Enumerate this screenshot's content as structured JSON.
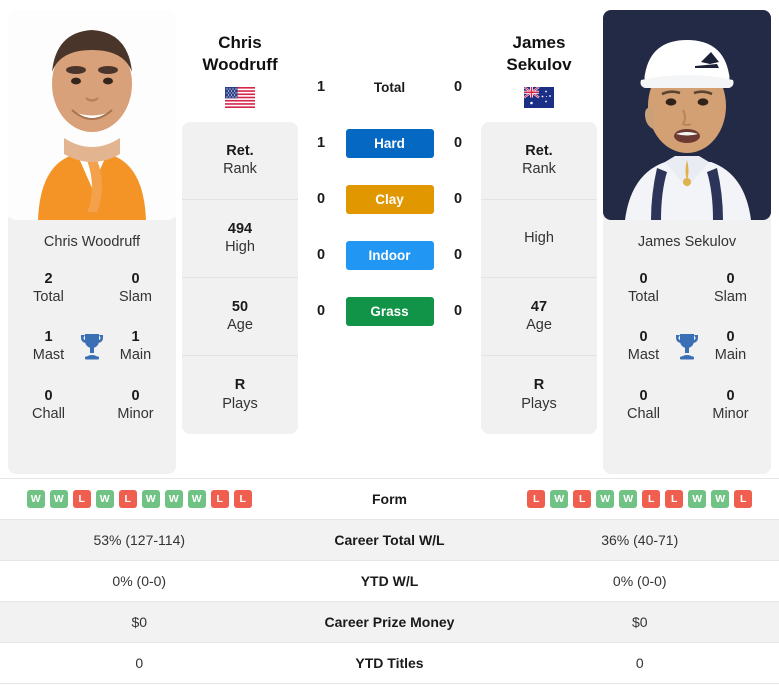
{
  "players": {
    "left": {
      "first_name": "Chris",
      "last_name": "Woodruff",
      "full_name": "Chris Woodruff",
      "country": "united-states",
      "rank": "Ret.",
      "rank_label": "Rank",
      "high": "494",
      "high_label": "High",
      "age": "50",
      "age_label": "Age",
      "plays": "R",
      "plays_label": "Plays",
      "titles": {
        "total": "2",
        "total_label": "Total",
        "slam": "0",
        "slam_label": "Slam",
        "mast": "1",
        "mast_label": "Mast",
        "main": "1",
        "main_label": "Main",
        "chall": "0",
        "chall_label": "Chall",
        "minor": "0",
        "minor_label": "Minor"
      },
      "form": [
        "W",
        "W",
        "L",
        "W",
        "L",
        "W",
        "W",
        "W",
        "L",
        "L"
      ],
      "career_total_wl": "53% (127-114)",
      "ytd_wl": "0% (0-0)",
      "career_prize_money": "$0",
      "ytd_titles": "0"
    },
    "right": {
      "first_name": "James",
      "last_name": "Sekulov",
      "full_name": "James Sekulov",
      "country": "australia",
      "rank": "Ret.",
      "rank_label": "Rank",
      "high": "",
      "high_label": "High",
      "age": "47",
      "age_label": "Age",
      "plays": "R",
      "plays_label": "Plays",
      "titles": {
        "total": "0",
        "total_label": "Total",
        "slam": "0",
        "slam_label": "Slam",
        "mast": "0",
        "mast_label": "Mast",
        "main": "0",
        "main_label": "Main",
        "chall": "0",
        "chall_label": "Chall",
        "minor": "0",
        "minor_label": "Minor"
      },
      "form": [
        "L",
        "W",
        "L",
        "W",
        "W",
        "L",
        "L",
        "W",
        "W",
        "L"
      ],
      "career_total_wl": "36% (40-71)",
      "ytd_wl": "0% (0-0)",
      "career_prize_money": "$0",
      "ytd_titles": "0"
    }
  },
  "head_to_head": [
    {
      "label": "Total",
      "left": "1",
      "right": "0",
      "style": "plain",
      "color": ""
    },
    {
      "label": "Hard",
      "left": "1",
      "right": "0",
      "style": "badge",
      "color": "#0569c4"
    },
    {
      "label": "Clay",
      "left": "0",
      "right": "0",
      "style": "badge",
      "color": "#e09700"
    },
    {
      "label": "Indoor",
      "left": "0",
      "right": "0",
      "style": "badge",
      "color": "#2196f3"
    },
    {
      "label": "Grass",
      "left": "0",
      "right": "0",
      "style": "badge",
      "color": "#119447"
    }
  ],
  "table_rows": [
    {
      "label": "Form",
      "type": "form"
    },
    {
      "label": "Career Total W/L",
      "type": "text",
      "left": "53% (127-114)",
      "right": "36% (40-71)"
    },
    {
      "label": "YTD W/L",
      "type": "text",
      "left": "0% (0-0)",
      "right": "0% (0-0)"
    },
    {
      "label": "Career Prize Money",
      "type": "text",
      "left": "$0",
      "right": "$0"
    },
    {
      "label": "YTD Titles",
      "type": "text",
      "left": "0",
      "right": "0"
    }
  ],
  "colors": {
    "hard": "#0569c4",
    "clay": "#e09700",
    "indoor": "#2196f3",
    "grass": "#119447",
    "win_badge": "#71c285",
    "loss_badge": "#ef5e4e",
    "trophy": "#3a6fb5",
    "card_bg": "#f1f1f1"
  }
}
